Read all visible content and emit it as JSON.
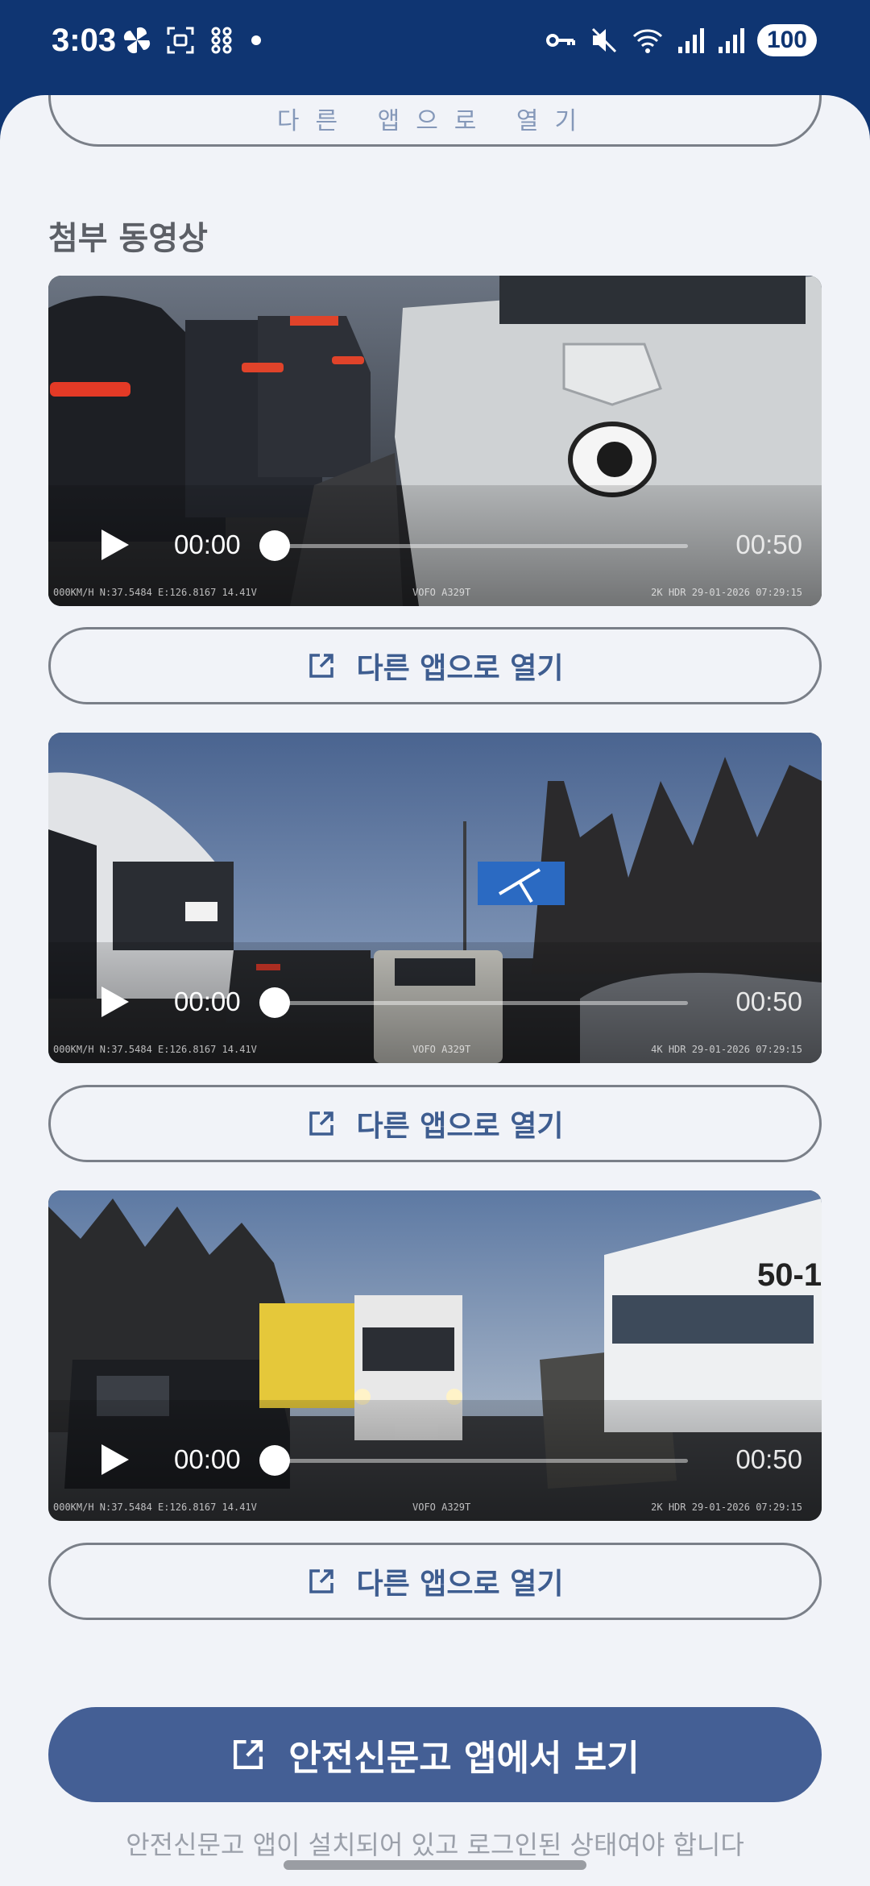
{
  "status_bar": {
    "time": "3:03",
    "battery": "100",
    "left_icons": [
      "pinwheel-icon",
      "screenshot-icon",
      "app-grid-icon",
      "dot-icon"
    ],
    "right_icons": [
      "vpn-key-icon",
      "mute-icon",
      "wifi-icon",
      "signal-icon",
      "signal-icon"
    ]
  },
  "section_title": "첨부 동영상",
  "videos": [
    {
      "current_time": "00:00",
      "duration": "00:50",
      "overlay_left": "000KM/H N:37.5484 E:126.8167  14.41V",
      "overlay_center": "VOFO A329T",
      "overlay_right": "2K HDR 29-01-2026 07:29:15"
    },
    {
      "current_time": "00:00",
      "duration": "00:50",
      "overlay_left": "000KM/H N:37.5484 E:126.8167  14.41V",
      "overlay_center": "VOFO A329T",
      "overlay_right": "4K HDR 29-01-2026 07:29:15"
    },
    {
      "current_time": "00:00",
      "duration": "00:50",
      "overlay_left": "000KM/H N:37.5484 E:126.8167  14.41V",
      "overlay_center": "VOFO A329T",
      "overlay_right": "2K HDR 29-01-2026 07:29:15"
    }
  ],
  "open_in_other_app_label": "다른 앱으로 열기",
  "primary_button_label": "안전신문고 앱에서 보기",
  "footer_note": "안전신문고 앱이 설치되어 있고 로그인된 상태여야 합니다"
}
